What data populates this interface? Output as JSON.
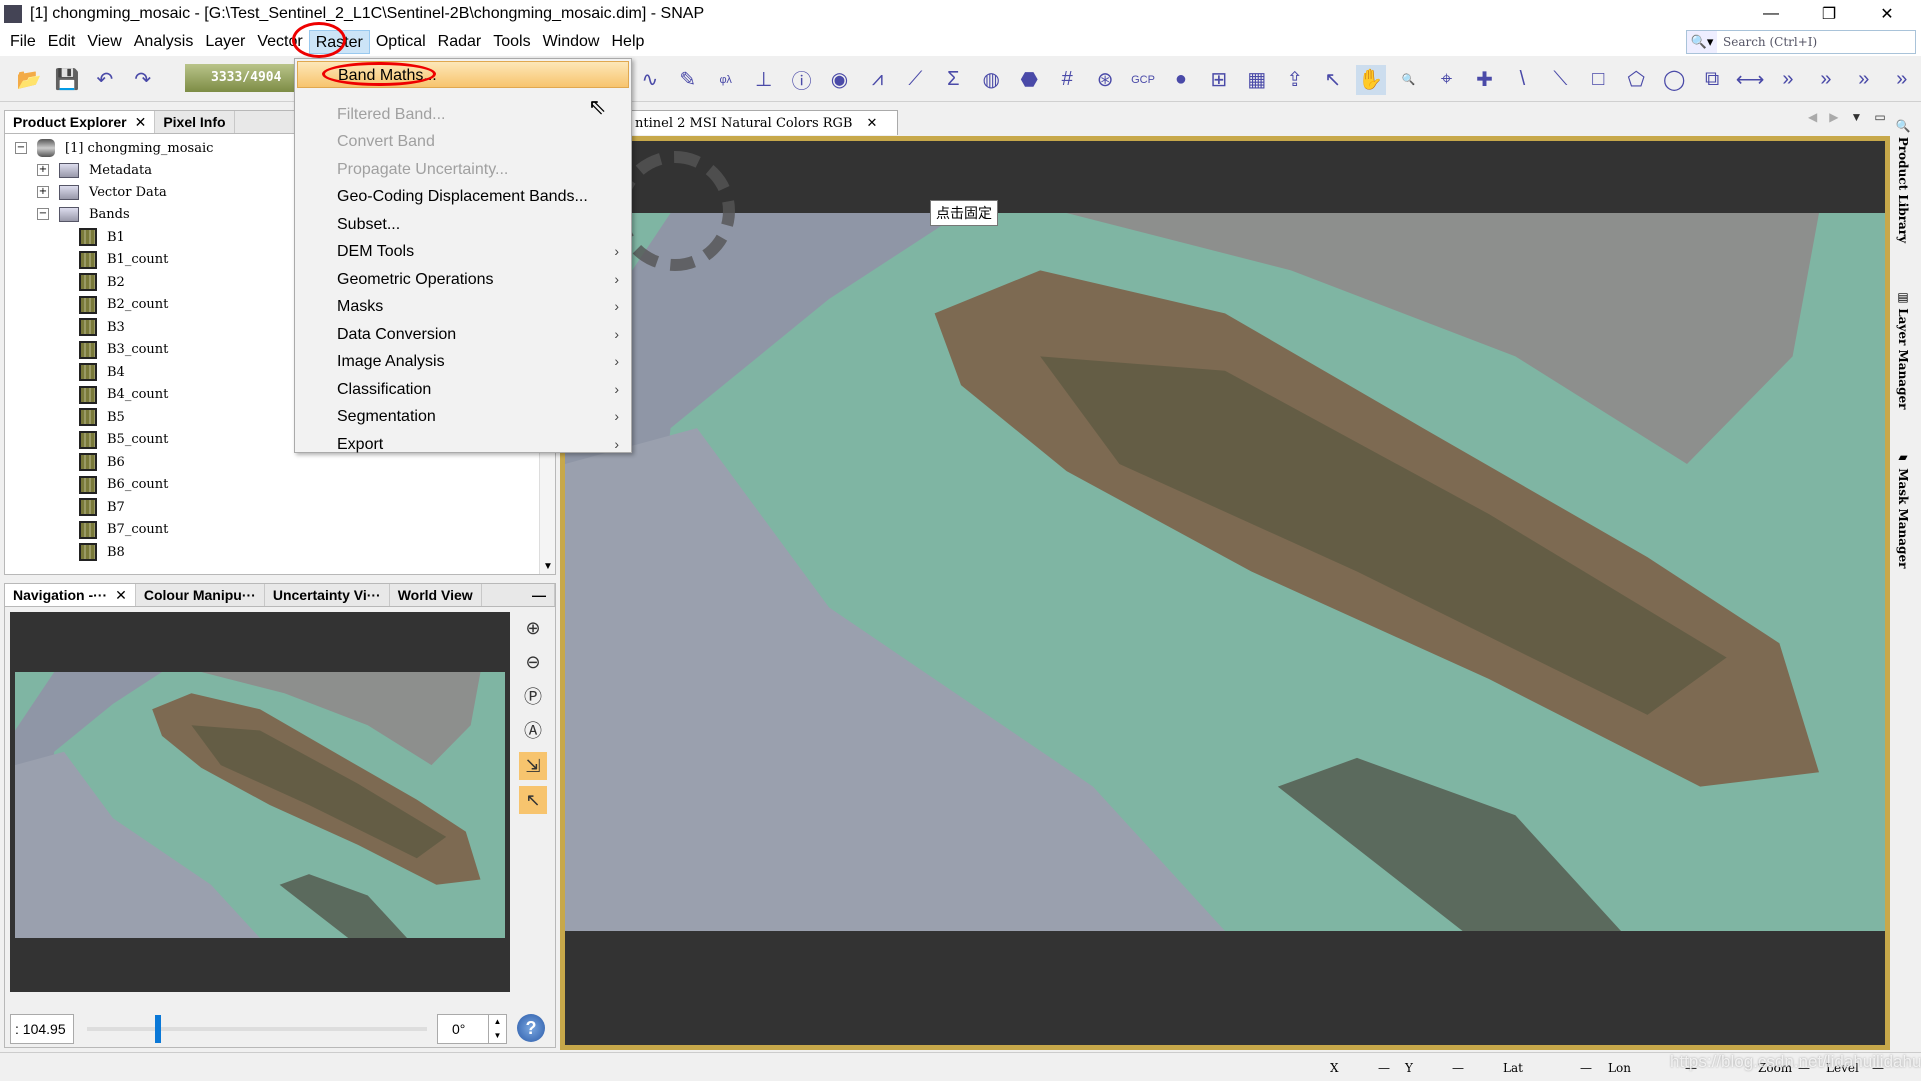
{
  "window": {
    "title": "[1] chongming_mosaic - [G:\\Test_Sentinel_2_L1C\\Sentinel-2B\\chongming_mosaic.dim] - SNAP",
    "controls": [
      "minimize",
      "restore",
      "close"
    ]
  },
  "menubar": [
    "File",
    "Edit",
    "View",
    "Analysis",
    "Layer",
    "Vector",
    "Raster",
    "Optical",
    "Radar",
    "Tools",
    "Window",
    "Help"
  ],
  "active_menu": "Raster",
  "search": {
    "placeholder": "Search (Ctrl+I)"
  },
  "toolbar": {
    "progress": "3333/4904",
    "icons": [
      "open-product-icon",
      "save-product-icon",
      "undo-icon",
      "redo-icon"
    ],
    "right_icons": [
      "spectrum-icon",
      "draw-icon",
      "phi-lambda-icon",
      "histogram-icon",
      "info-icon",
      "scatter-icon",
      "profile-icon",
      "plot-icon",
      "sigma-icon",
      "globe-icon",
      "pin-icon",
      "grid-icon",
      "gcp-icon",
      "gcp2-icon",
      "gcp3-icon",
      "mosaic-icon",
      "graph-icon",
      "export-icon",
      "select-icon",
      "pan-icon",
      "zoom-icon",
      "pixel-icon",
      "gcp-add-icon",
      "line-icon",
      "polyline-icon",
      "rectangle-icon",
      "polygon-icon",
      "ellipse-icon",
      "insert-figure-icon",
      "range-finder-icon",
      "more-icon",
      "more-icon",
      "more-icon",
      "more-icon"
    ]
  },
  "raster_menu": [
    {
      "label": "Band Maths...",
      "enabled": true,
      "highlight": true
    },
    {
      "label": "Filtered Band...",
      "enabled": false
    },
    {
      "label": "Convert Band",
      "enabled": false
    },
    {
      "label": "Propagate Uncertainty...",
      "enabled": false
    },
    {
      "label": "Geo-Coding Displacement Bands...",
      "enabled": true
    },
    {
      "label": "Subset...",
      "enabled": true
    },
    {
      "label": "DEM Tools",
      "enabled": true,
      "submenu": true
    },
    {
      "label": "Geometric Operations",
      "enabled": true,
      "submenu": true
    },
    {
      "label": "Masks",
      "enabled": true,
      "submenu": true
    },
    {
      "label": "Data Conversion",
      "enabled": true,
      "submenu": true
    },
    {
      "label": "Image Analysis",
      "enabled": true,
      "submenu": true
    },
    {
      "label": "Classification",
      "enabled": true,
      "submenu": true
    },
    {
      "label": "Segmentation",
      "enabled": true,
      "submenu": true
    },
    {
      "label": "Export",
      "enabled": true,
      "submenu": true
    }
  ],
  "product_explorer": {
    "tabs": [
      "Product Explorer",
      "Pixel Info"
    ],
    "product": "[1]  chongming_mosaic",
    "groups": [
      "Metadata",
      "Vector Data",
      "Bands"
    ],
    "bands": [
      "B1",
      "B1_count",
      "B2",
      "B2_count",
      "B3",
      "B3_count",
      "B4",
      "B4_count",
      "B5",
      "B5_count",
      "B6",
      "B6_count",
      "B7",
      "B7_count",
      "B8"
    ]
  },
  "navigation": {
    "tabs": [
      "Navigation -···",
      "Colour Manipu···",
      "Uncertainty Vi···",
      "World View"
    ],
    "zoom_value": ": 104.95",
    "rotation": "0°",
    "slider_fraction": 0.2
  },
  "view": {
    "tab": "ntinel 2 MSI Natural Colors RGB",
    "tooltip": "点击固定"
  },
  "right_panels": [
    "Product Library",
    "Layer Manager",
    "Mask Manager"
  ],
  "status": {
    "X": "X",
    "Xv": "—",
    "Y": "Y",
    "Yv": "—",
    "Lat": "Lat",
    "Latv": "—",
    "Lon": "Lon",
    "Lonv": "—",
    "Zoom": "Zoom",
    "Zoomv": "—",
    "Level": "Level",
    "Levelv": "—"
  },
  "watermark": "https://blog.csdn.net/lidahuilidahui",
  "colors": {
    "water": "#7fb5a3",
    "land": "#8c7a62",
    "highlight": "#f7c46e",
    "annotation": "#e00000"
  }
}
